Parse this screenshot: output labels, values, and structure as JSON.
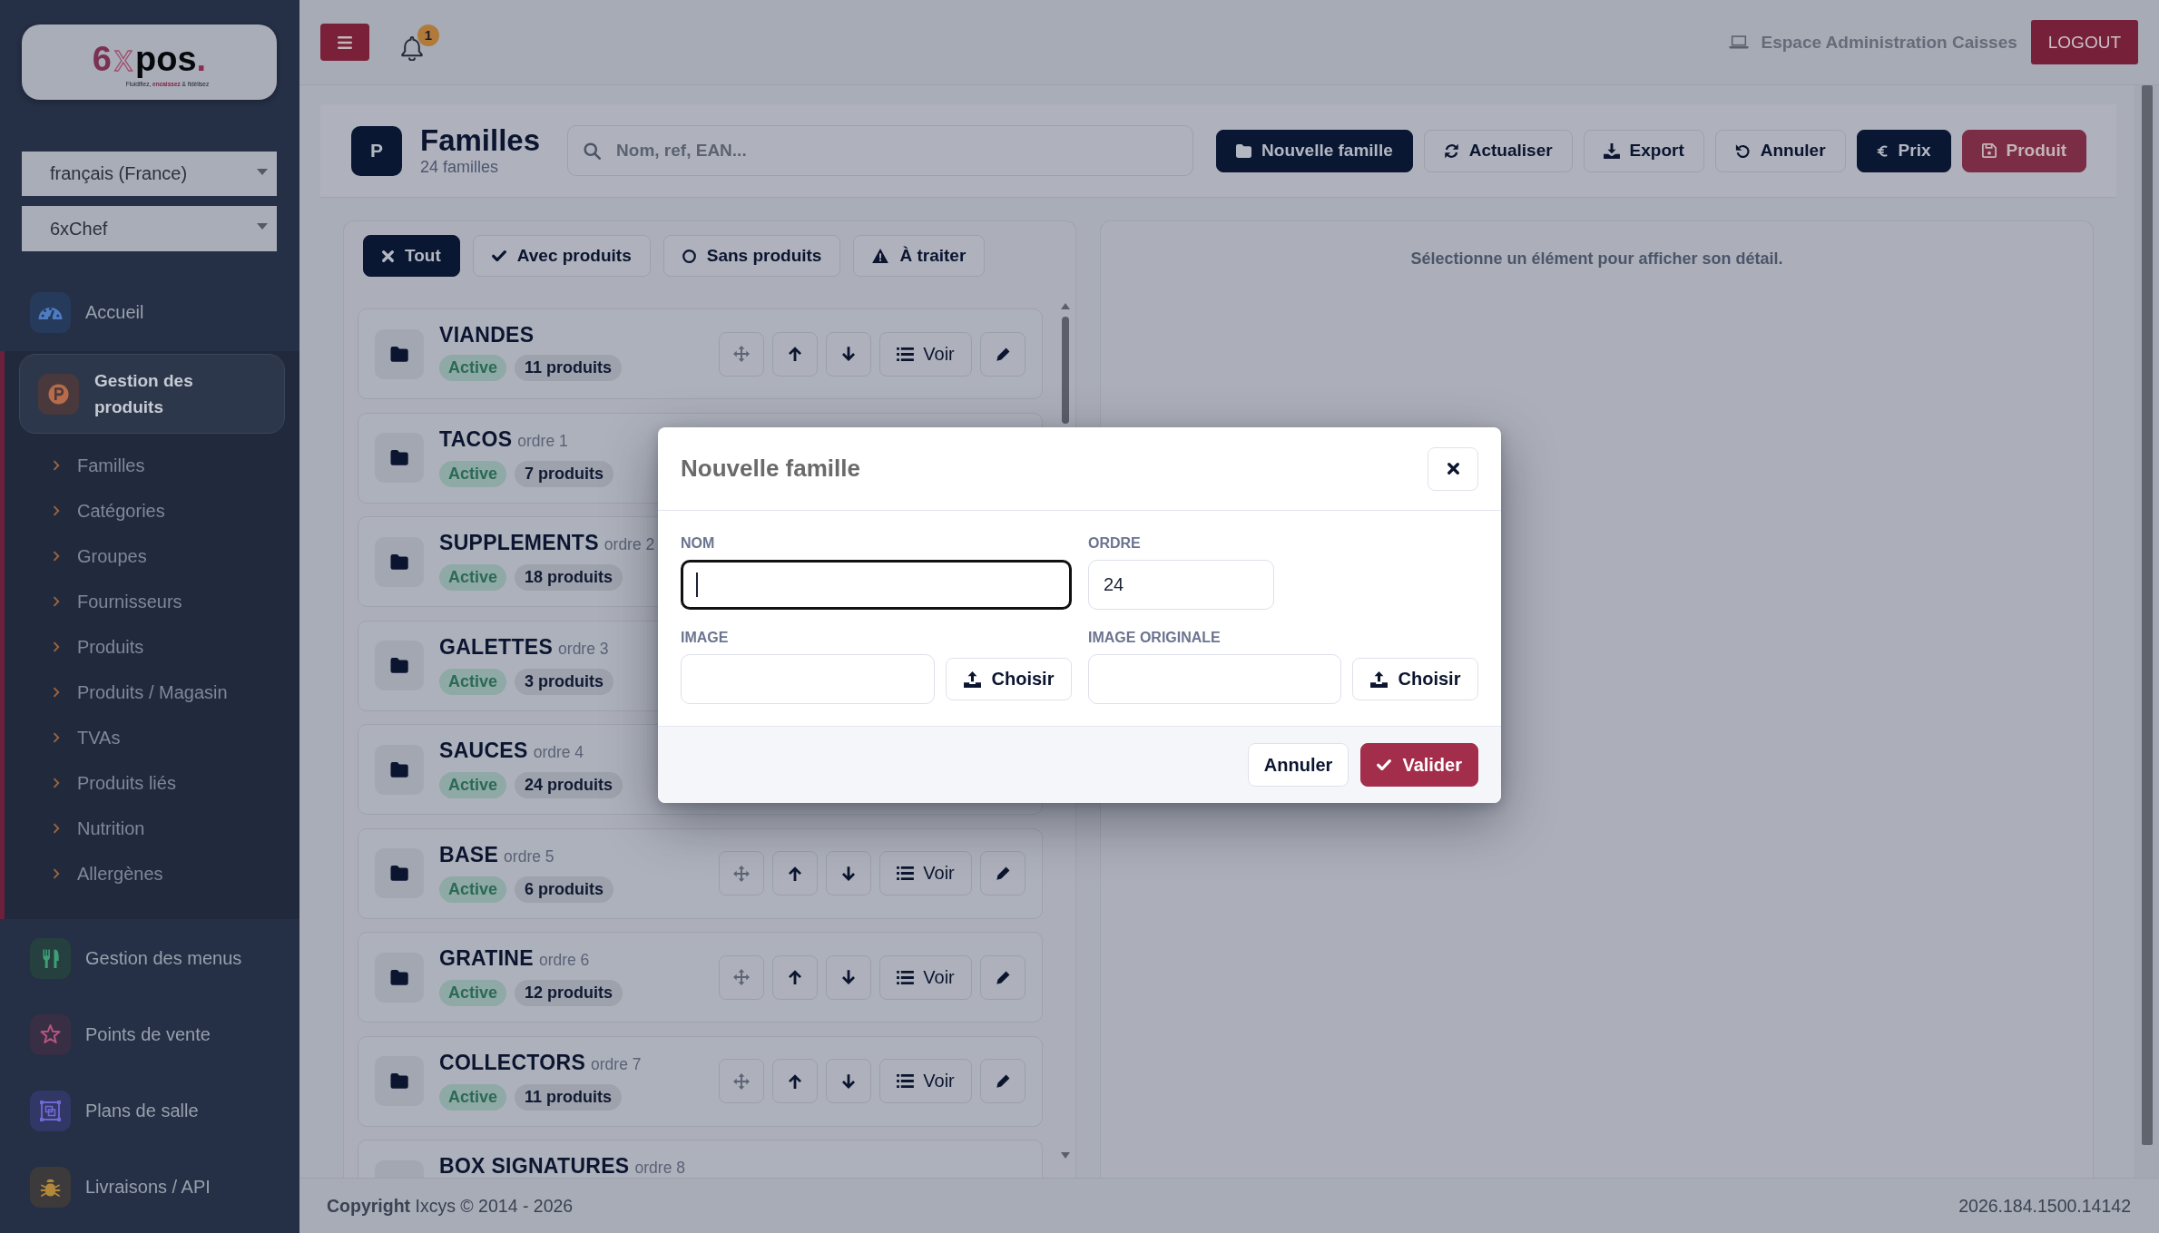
{
  "sidebar": {
    "logo": {
      "lead": "6",
      "mark": "x",
      "name": "pos",
      "dot": ".",
      "tagline": "Fluidifiez, **encaissez** & fidélisez"
    },
    "language_select": {
      "value": "français (France)"
    },
    "store_select": {
      "value": "6xChef"
    },
    "nav": [
      {
        "label": "Accueil",
        "expanded": false
      },
      {
        "label": "Gestion des produits",
        "expanded": true,
        "children": [
          {
            "label": "Familles"
          },
          {
            "label": "Catégories"
          },
          {
            "label": "Groupes"
          },
          {
            "label": "Fournisseurs"
          },
          {
            "label": "Produits"
          },
          {
            "label": "Produits / Magasin"
          },
          {
            "label": "TVAs"
          },
          {
            "label": "Produits liés"
          },
          {
            "label": "Nutrition"
          },
          {
            "label": "Allergènes"
          }
        ]
      },
      {
        "label": "Gestion des menus",
        "expanded": false
      },
      {
        "label": "Points de vente",
        "expanded": false
      },
      {
        "label": "Plans de salle",
        "expanded": false
      },
      {
        "label": "Livraisons / API",
        "expanded": false
      }
    ]
  },
  "topbar": {
    "notifications": {
      "count": "1"
    },
    "workspace_label": "Espace Administration Caisses",
    "logout_label": "LOGOUT"
  },
  "page_header": {
    "badge": "P",
    "title": "Familles",
    "subtitle": "24 familles",
    "search": {
      "placeholder": "Nom, ref, EAN..."
    },
    "actions": [
      {
        "label": "Nouvelle famille",
        "kind": "primary"
      },
      {
        "label": "Actualiser",
        "kind": "outline"
      },
      {
        "label": "Export",
        "kind": "outline"
      },
      {
        "label": "Annuler",
        "kind": "outline"
      },
      {
        "label": "Prix",
        "kind": "primary"
      },
      {
        "label": "Produit",
        "kind": "danger"
      }
    ]
  },
  "filters": [
    {
      "label": "Tout",
      "selected": true
    },
    {
      "label": "Avec produits",
      "selected": false
    },
    {
      "label": "Sans produits",
      "selected": false
    },
    {
      "label": "À traiter",
      "selected": false
    }
  ],
  "families": [
    {
      "name": "VIANDES",
      "status": "Active",
      "count": "11 produits",
      "view_label": "Voir"
    },
    {
      "name": "TACOS",
      "order": "ordre 1",
      "status": "Active",
      "count": "7 produits"
    },
    {
      "name": "SUPPLEMENTS",
      "order": "ordre 2",
      "status": "Active",
      "count": "18 produits"
    },
    {
      "name": "GALETTES",
      "order": "ordre 3",
      "status": "Active",
      "count": "3 produits"
    },
    {
      "name": "SAUCES",
      "order": "ordre 4",
      "status": "Active",
      "count": "24 produits"
    },
    {
      "name": "BASE",
      "order": "ordre 5",
      "status": "Active",
      "count": "6 produits",
      "view_label": "Voir"
    },
    {
      "name": "GRATINE",
      "order": "ordre 6",
      "status": "Active",
      "count": "12 produits",
      "view_label": "Voir"
    },
    {
      "name": "COLLECTORS",
      "order": "ordre 7",
      "status": "Active",
      "count": "11 produits",
      "view_label": "Voir"
    },
    {
      "name": "BOX SIGNATURES",
      "order": "ordre 8"
    }
  ],
  "detail_panel": {
    "empty_message": "Sélectionne un élément pour afficher son détail."
  },
  "modal": {
    "title": "Nouvelle famille",
    "fields": [
      {
        "label": "NOM",
        "kind": "text",
        "focused": true
      },
      {
        "label": "ORDRE",
        "kind": "text",
        "value": "24",
        "focused": false
      },
      {
        "label": "IMAGE",
        "kind": "file",
        "button": "Choisir",
        "focused": false
      },
      {
        "label": "IMAGE ORIGINALE",
        "kind": "file",
        "button": "Choisir",
        "focused": false
      }
    ],
    "buttons": [
      {
        "label": "Annuler",
        "kind": "secondary"
      },
      {
        "label": "Valider",
        "kind": "primary"
      }
    ]
  },
  "footer": {
    "copyright": "**Copyright** Ixcys © 2014 - 2026",
    "version": "2026.184.1500.14142"
  }
}
